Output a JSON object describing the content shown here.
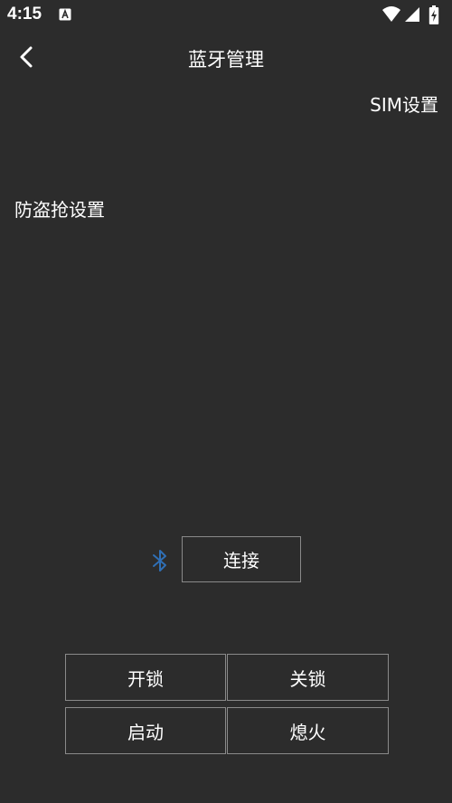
{
  "status_bar": {
    "time": "4:15",
    "icons": [
      "app-a-icon",
      "wifi-icon",
      "signal-icon",
      "battery-charging-icon"
    ]
  },
  "header": {
    "title": "蓝牙管理",
    "back_icon": "chevron-left-icon"
  },
  "menu": {
    "sim_settings": "SIM设置",
    "antitheft_settings": "防盗抢设置"
  },
  "bluetooth": {
    "icon": "bluetooth-icon",
    "icon_color": "#2f6fb5",
    "connect_label": "连接"
  },
  "controls": {
    "unlock": "开锁",
    "lock": "关锁",
    "start": "启动",
    "engine_off": "熄火"
  },
  "colors": {
    "background": "#2c2c2c",
    "button_border": "#8a8a8a",
    "text": "#ffffff"
  }
}
